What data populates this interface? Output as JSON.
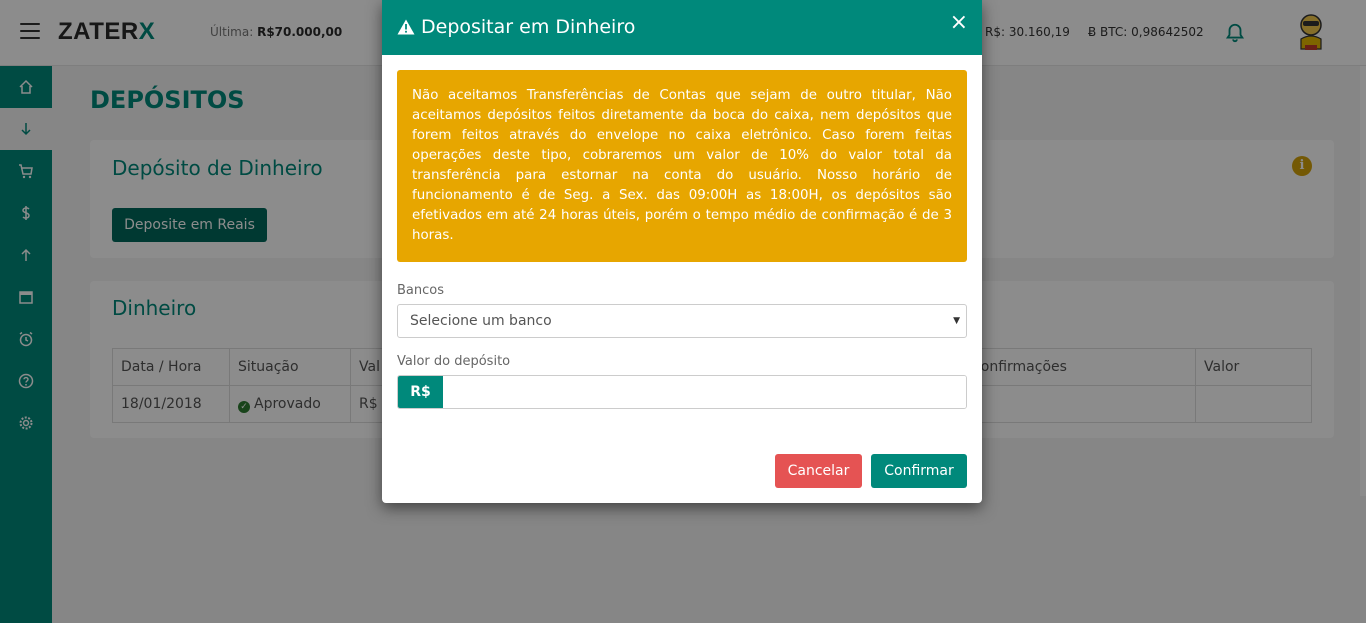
{
  "header": {
    "logo_main": "ZATER",
    "logo_x": "X",
    "last_label": "Última:",
    "last_value": "R$70.000,00",
    "balance_brl": "R$: 30.160,19",
    "balance_btc": "BTC: 0,98642502"
  },
  "page": {
    "title": "DEPÓSITOS"
  },
  "deposit_card": {
    "title": "Depósito de Dinheiro",
    "button_label": "Deposite em Reais"
  },
  "money_card": {
    "title": "Dinheiro",
    "columns": [
      "Data / Hora",
      "Situação",
      "Val",
      "Confirmações",
      "Valor"
    ],
    "rows": [
      {
        "date": "18/01/2018",
        "status": "Aprovado",
        "value": "R$"
      }
    ]
  },
  "modal": {
    "title": "Depositar em Dinheiro",
    "close": "×",
    "alert_text": "Não aceitamos Transferências de Contas que sejam de outro titular, Não aceitamos depósitos feitos diretamente da boca do caixa, nem depósitos que forem feitos através do envelope no caixa eletrônico. Caso forem feitas operações deste tipo, cobraremos um valor de 10% do valor total da transferência para estornar na conta do usuário. Nosso horário de funcionamento é de Seg. a Sex. das 09:00H as 18:00H, os depósitos são efetivados em até 24 horas úteis, porém o tempo médio de confirmação é de 3 horas.",
    "banks_label": "Bancos",
    "banks_selected": "Selecione um banco",
    "value_label": "Valor do depósito",
    "currency_addon": "R$",
    "value_input": "",
    "cancel_label": "Cancelar",
    "confirm_label": "Confirmar"
  },
  "colors": {
    "primary": "#00897b",
    "primary_dark": "#00695c",
    "alert": "#e7a600",
    "danger": "#e55353"
  }
}
